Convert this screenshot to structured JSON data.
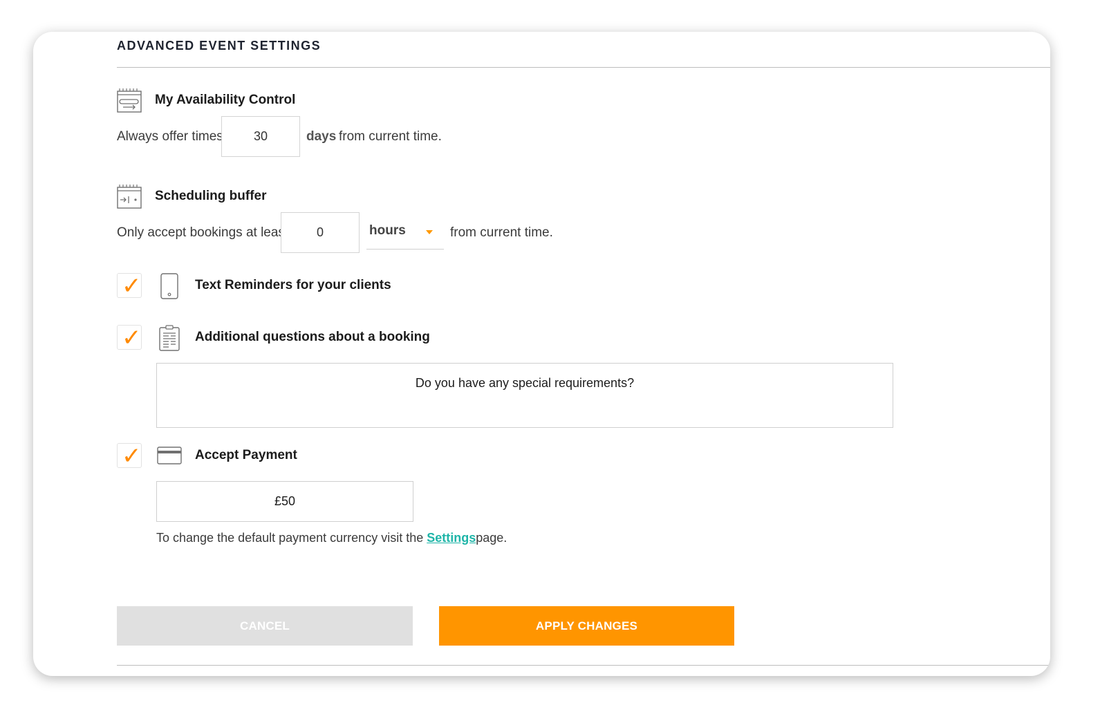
{
  "section": {
    "title": "ADVANCED EVENT SETTINGS"
  },
  "availability": {
    "heading": "My Availability Control",
    "prefix": "Always offer times",
    "value": "30",
    "unit": "days",
    "suffix": "from current time.",
    "icon": "calendar-range-icon"
  },
  "buffer": {
    "heading": "Scheduling buffer",
    "prefix": "Only accept bookings at least",
    "value": "0",
    "unit_selected": "hours",
    "suffix": "from current time.",
    "icon": "calendar-buffer-icon"
  },
  "text_reminders": {
    "label": "Text Reminders for your clients",
    "checked": true,
    "icon": "phone-icon"
  },
  "questions": {
    "label": "Additional questions about a booking",
    "checked": true,
    "icon": "clipboard-icon",
    "question_text": "Do you have any special requirements?"
  },
  "payment": {
    "label": "Accept Payment",
    "checked": true,
    "icon": "credit-card-icon",
    "amount": "£50",
    "note_prefix": "To change the default payment currency visit the",
    "note_link": "Settings",
    "note_suffix": "page."
  },
  "checkmark_glyph": "✓",
  "buttons": {
    "cancel": "CANCEL",
    "apply": "APPLY CHANGES"
  },
  "colors": {
    "accent": "#ff9500",
    "link": "#1fb5a8",
    "cancel_bg": "#e0e0e0"
  }
}
